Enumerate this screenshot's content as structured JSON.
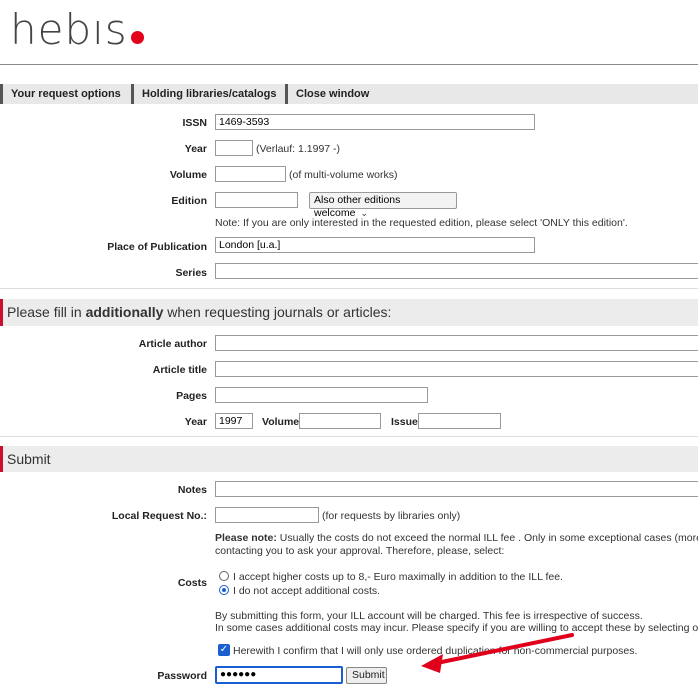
{
  "logo": {
    "text": "hebıs",
    "dot_color": "#e2001a"
  },
  "tabs": [
    "Your request options",
    "Holding libraries/catalogs",
    "Close window"
  ],
  "form": {
    "issn": {
      "label": "ISSN",
      "value": "1469-3593"
    },
    "year": {
      "label": "Year",
      "value": "",
      "hint": "(Verlauf: 1.1997 -)"
    },
    "volume": {
      "label": "Volume",
      "value": "",
      "hint": "(of multi-volume works)"
    },
    "edition": {
      "label": "Edition",
      "value": "",
      "select": "Also other editions welcome",
      "note": "Note: If you are only interested in the requested edition, please select 'ONLY this edition'."
    },
    "place": {
      "label": "Place of Publication",
      "value": "London [u.a.]"
    },
    "series": {
      "label": "Series",
      "value": ""
    }
  },
  "section_journals": {
    "prefix": "Please fill in ",
    "bold": "additionally",
    "suffix": " when requesting journals or articles:"
  },
  "journal": {
    "article_author": "Article author",
    "article_title": "Article title",
    "pages": "Pages",
    "year_label": "Year",
    "year_value": "1997",
    "volume_label": "Volume",
    "issue_label": "Issue"
  },
  "section_submit": "Submit",
  "submit": {
    "notes_label": "Notes",
    "local_label": "Local Request No.:",
    "local_hint": "(for requests by libraries only)",
    "please_note_bold": "Please note:",
    "please_note_1": " Usually the costs do not exceed the normal ILL fee . Only in some exceptional cases (more than",
    "please_note_2": "contacting you to ask your approval. Therefore, please, select:",
    "costs_label": "Costs",
    "cost_option_1": "I accept higher costs up to 8,- Euro maximally in addition to the ILL fee.",
    "cost_option_2": "I do not accept additional costs.",
    "charge_1": "By submitting this form, your ILL account will be charged. This fee is irrespective of success.",
    "charge_2": "In some cases additional costs may incur. Please specify if you are willing to accept these by selecting one of",
    "confirm": "Herewith I confirm that I will only use ordered duplication for non-commercial purposes.",
    "password_label": "Password",
    "password_value": "●●●●●●",
    "submit_button": "Submit"
  },
  "annotation_color": "#e0001b"
}
